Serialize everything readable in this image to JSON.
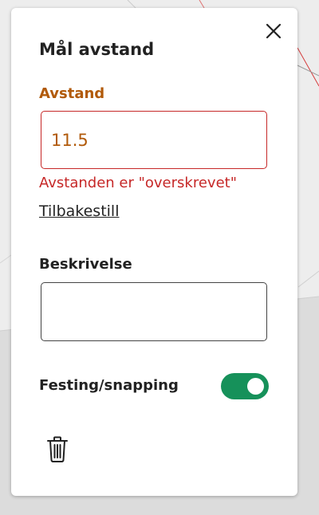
{
  "panel": {
    "title": "Mål avstand",
    "close_icon": "close-icon"
  },
  "distance": {
    "label": "Avstand",
    "value": "11.5",
    "error": "Avstanden er \"overskrevet\"",
    "reset_link": "Tilbakestill"
  },
  "description": {
    "label": "Beskrivelse",
    "value": ""
  },
  "snapping": {
    "label": "Festing/snapping",
    "enabled": true
  },
  "delete": {
    "icon": "trash-icon"
  },
  "colors": {
    "label_accent": "#b15a0a",
    "input_value": "#b15a0a",
    "error": "#c62828",
    "toggle_on": "#16915a",
    "text": "#222222"
  }
}
